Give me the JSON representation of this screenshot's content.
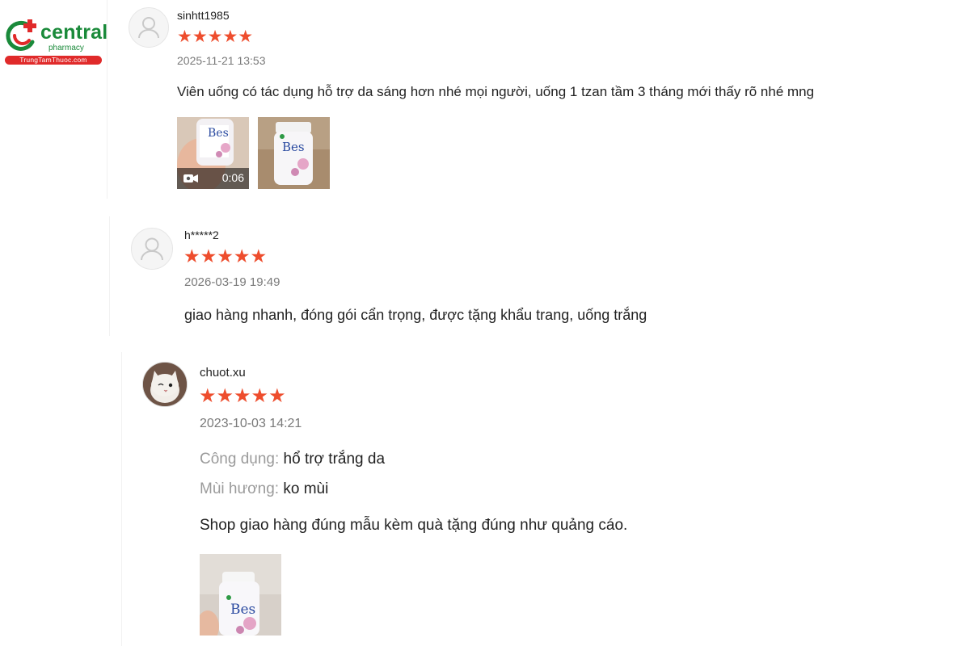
{
  "brand": {
    "name": "central",
    "tagline": "pharmacy",
    "site": "TrungTamThuoc.com",
    "colors": {
      "green": "#1a8a3a",
      "red": "#e02a2a",
      "star": "#ee4d2d"
    }
  },
  "reviews": [
    {
      "username": "sinhtt1985",
      "rating": 5,
      "stars": "★★★★★",
      "date": "2025-11-21 13:53",
      "text": "Viên uống có tác dụng hỗ trợ da sáng hơn nhé mọi người, uống 1 tzan tầm 3 tháng mới thấy rõ nhé mng",
      "media": [
        {
          "type": "video",
          "duration": "0:06",
          "icon": "video-camera-icon"
        },
        {
          "type": "image"
        }
      ]
    },
    {
      "username": "h*****2",
      "rating": 5,
      "stars": "★★★★★",
      "date": "2026-03-19 19:49",
      "text": "giao hàng nhanh, đóng gói cẩn trọng, được tặng khẩu trang, uống trắng"
    },
    {
      "username": "chuot.xu",
      "rating": 5,
      "stars": "★★★★★",
      "date": "2023-10-03 14:21",
      "attributes": [
        {
          "key": "Công dụng:",
          "value": "hổ trợ trắng da"
        },
        {
          "key": "Mùi hương:",
          "value": "ko mùi"
        }
      ],
      "text": "Shop giao hàng đúng mẫu kèm quà tặng đúng như quảng cáo.",
      "media": [
        {
          "type": "image"
        }
      ]
    }
  ]
}
